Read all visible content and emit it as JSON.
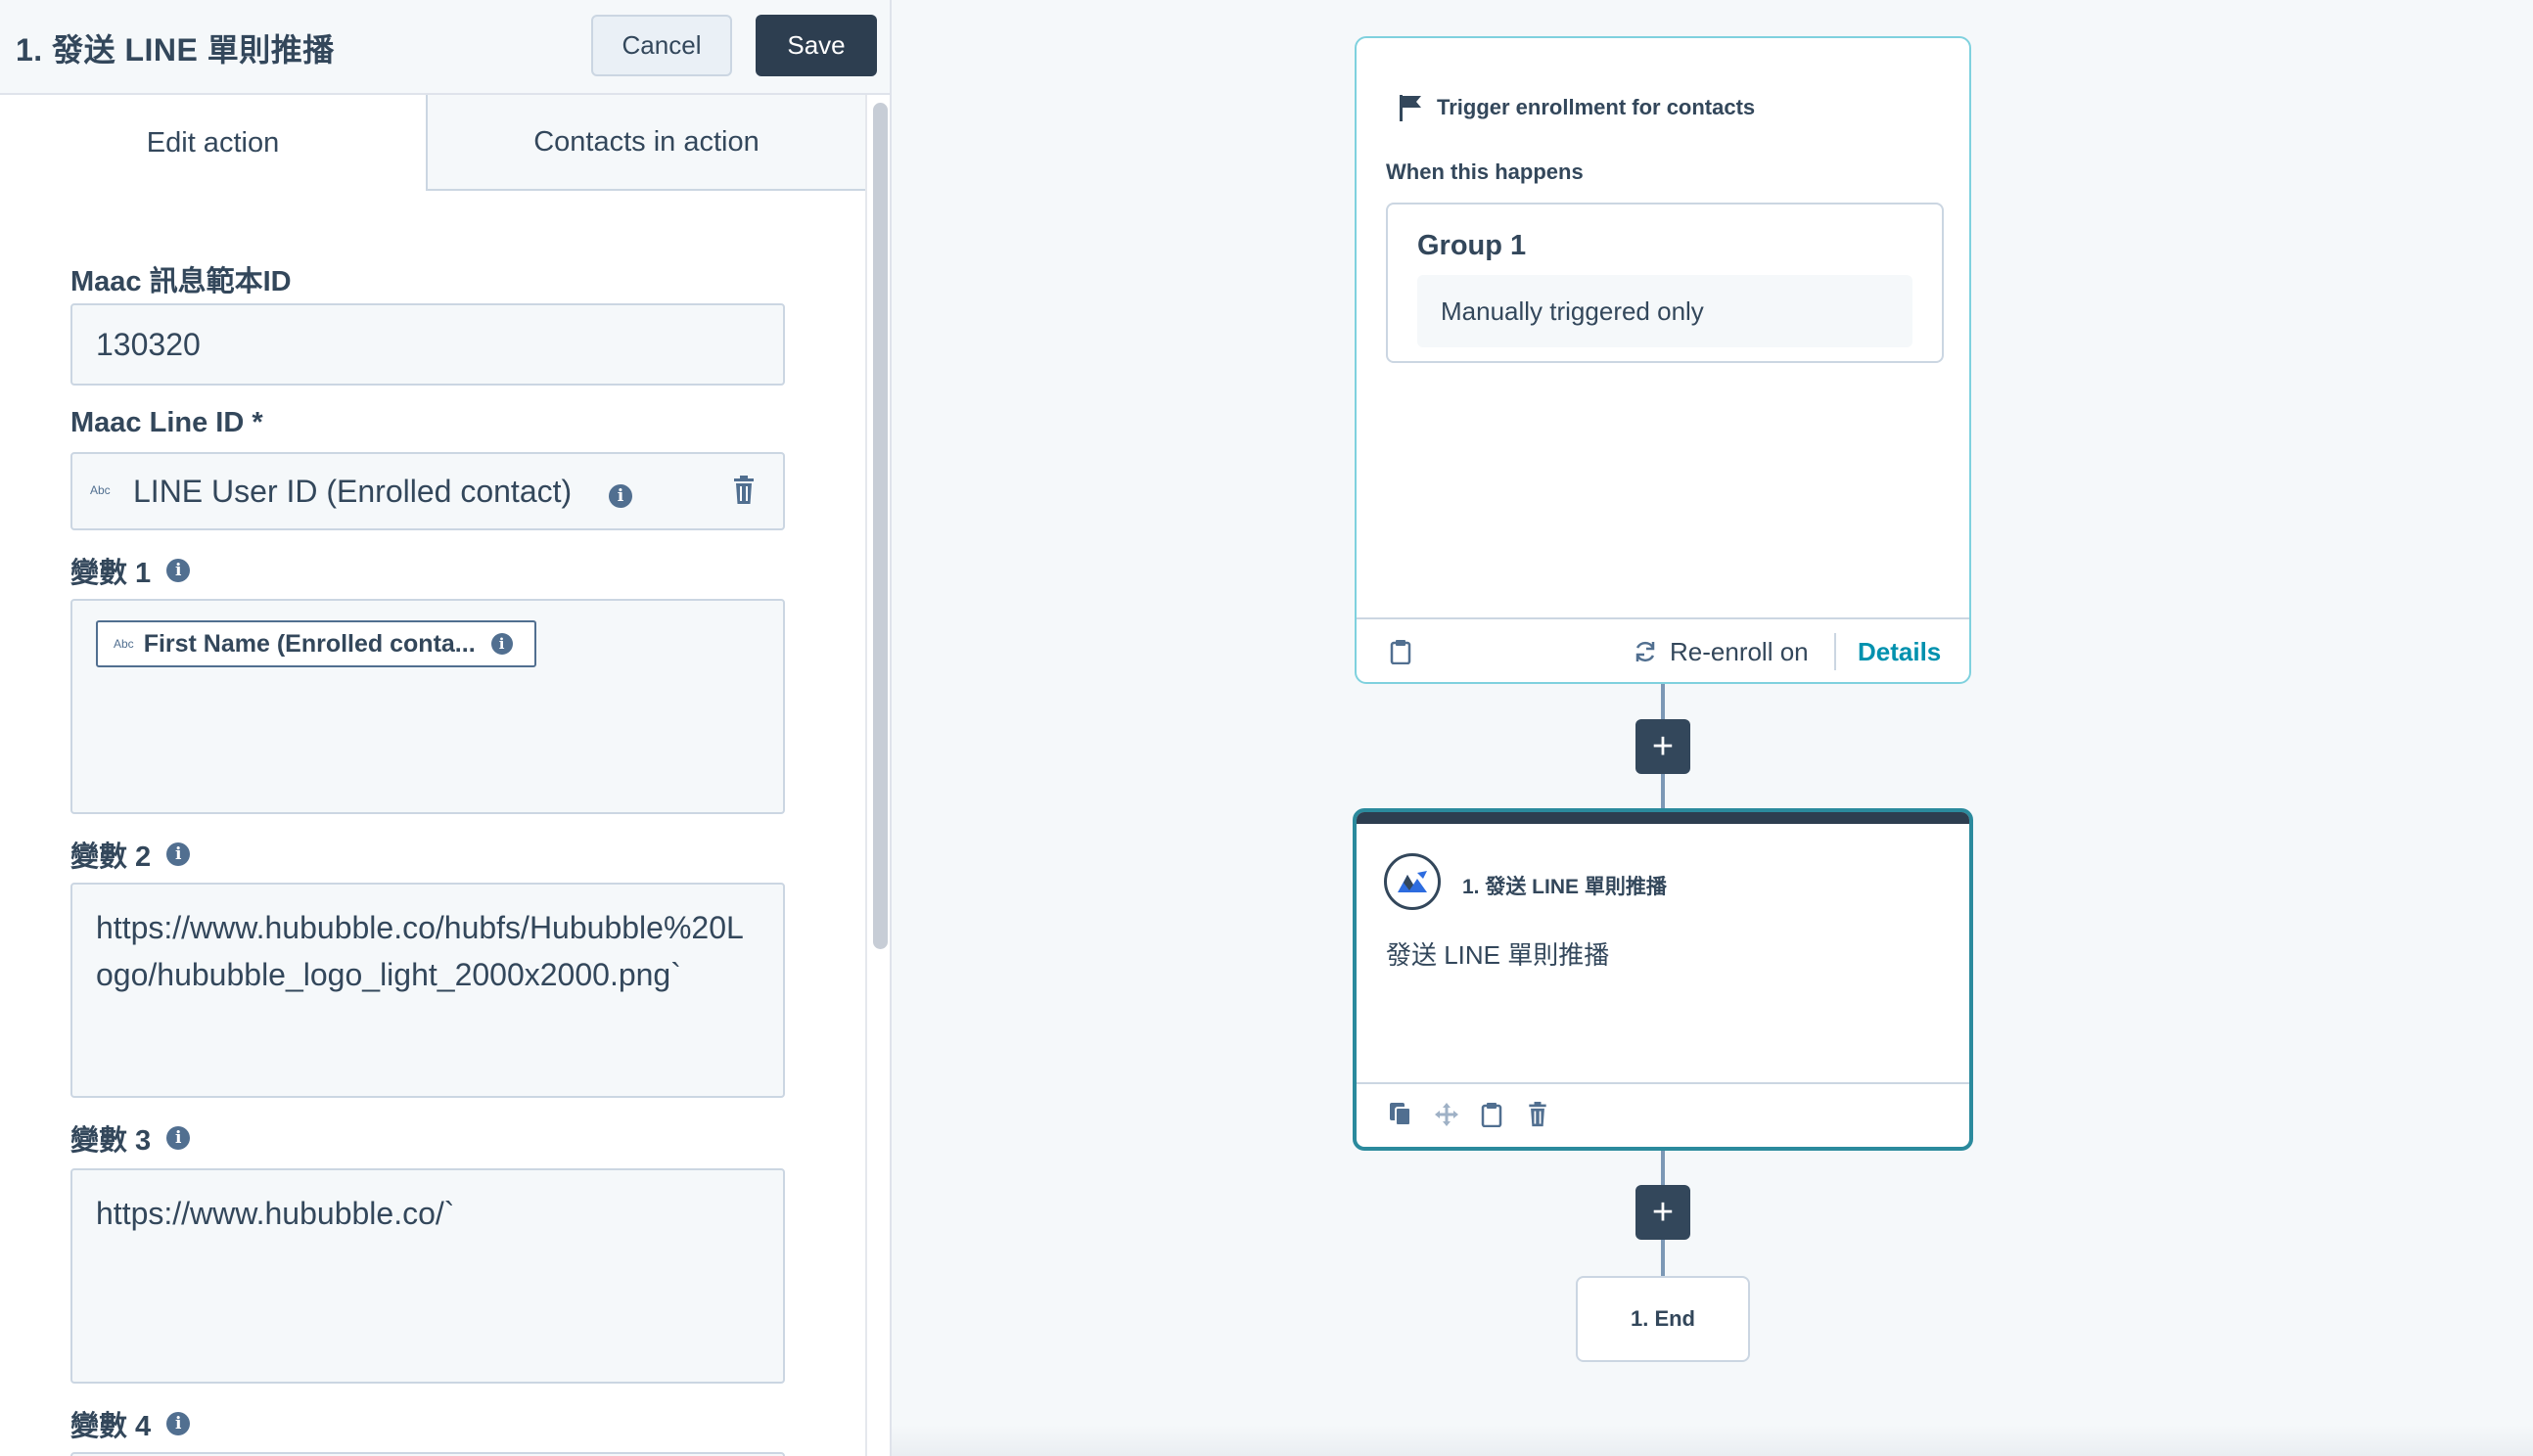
{
  "panel": {
    "title": "1. 發送 LINE 單則推播",
    "cancel_label": "Cancel",
    "save_label": "Save",
    "tabs": [
      {
        "label": "Edit action",
        "active": true
      },
      {
        "label": "Contacts in action",
        "active": false
      }
    ]
  },
  "fields": {
    "template_id": {
      "label": "Maac 訊息範本ID",
      "value": "130320"
    },
    "line_id": {
      "label": "Maac Line ID *",
      "type_tag": "Abc",
      "value": "LINE User ID (Enrolled contact)"
    },
    "var1": {
      "label": "變數 1",
      "type_tag": "Abc",
      "token": "First Name (Enrolled conta..."
    },
    "var2": {
      "label": "變數 2",
      "value": "https://www.hububble.co/hubfs/Hububble%20Logo/hububble_logo_light_2000x2000.png`"
    },
    "var3": {
      "label": "變數 3",
      "value": "https://www.hububble.co/`"
    },
    "var4": {
      "label": "變數 4"
    }
  },
  "workflow": {
    "trigger": {
      "heading": "Trigger enrollment for contacts",
      "when_label": "When this happens",
      "group_title": "Group 1",
      "condition": "Manually triggered only",
      "reenroll_label": "Re-enroll on",
      "details_label": "Details"
    },
    "action": {
      "title": "1. 發送 LINE 單則推播",
      "description": "發送 LINE 單則推播"
    },
    "end_label": "1. End",
    "plus_symbol": "+"
  },
  "icons": {
    "flag": "flag-icon",
    "clipboard": "clipboard-icon",
    "refresh": "refresh-icon",
    "copy": "copy-icon",
    "move": "move-icon",
    "trash": "trash-icon",
    "info": "info-icon",
    "app_logo": "maac-logo-icon"
  },
  "colors": {
    "primary_dark": "#2d3e50",
    "accent_teal": "#0091ae",
    "selected_border": "#2b8a9d",
    "trigger_border": "#7fd1de",
    "text": "#33475b"
  }
}
